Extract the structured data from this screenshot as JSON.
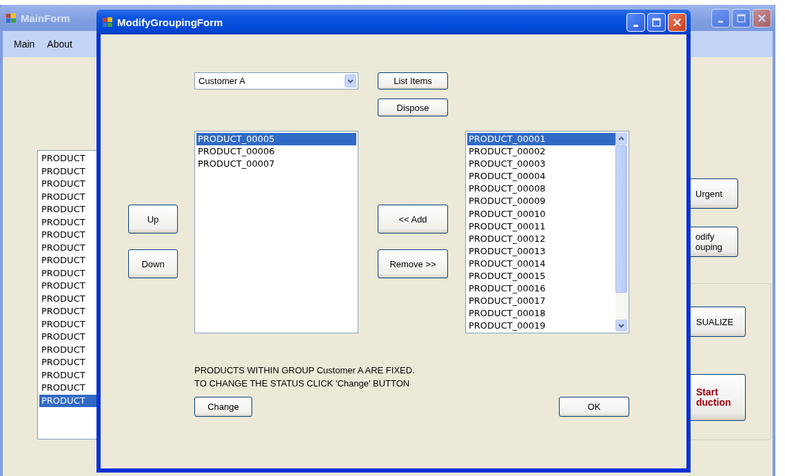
{
  "main_window": {
    "title": "MainForm",
    "menu": [
      {
        "label": "Main"
      },
      {
        "label": "About"
      }
    ],
    "product_list": [
      {
        "label": "PRODUCT",
        "selected": false
      },
      {
        "label": "PRODUCT",
        "selected": false
      },
      {
        "label": "PRODUCT",
        "selected": false
      },
      {
        "label": "PRODUCT",
        "selected": false
      },
      {
        "label": "PRODUCT",
        "selected": false
      },
      {
        "label": "PRODUCT",
        "selected": false
      },
      {
        "label": "PRODUCT",
        "selected": false
      },
      {
        "label": "PRODUCT",
        "selected": false
      },
      {
        "label": "PRODUCT",
        "selected": false
      },
      {
        "label": "PRODUCT",
        "selected": false
      },
      {
        "label": "PRODUCT",
        "selected": false
      },
      {
        "label": "PRODUCT",
        "selected": false
      },
      {
        "label": "PRODUCT",
        "selected": false
      },
      {
        "label": "PRODUCT",
        "selected": false
      },
      {
        "label": "PRODUCT",
        "selected": false
      },
      {
        "label": "PRODUCT",
        "selected": false
      },
      {
        "label": "PRODUCT",
        "selected": false
      },
      {
        "label": "PRODUCT",
        "selected": false
      },
      {
        "label": "PRODUCT",
        "selected": false
      },
      {
        "label": "PRODUCT",
        "selected": true
      }
    ],
    "buttons": [
      {
        "lines": [
          "Urgent"
        ],
        "kind": "plain"
      },
      {
        "lines": [
          "odify",
          "ouping"
        ],
        "kind": "plain"
      }
    ],
    "group_buttons": [
      {
        "lines": [
          "SUALIZE"
        ],
        "kind": "plain"
      },
      {
        "lines": [
          "Start",
          "duction"
        ],
        "kind": "emphasis"
      }
    ]
  },
  "dialog": {
    "title": "ModifyGroupingForm",
    "group_select": {
      "value": "Customer A"
    },
    "list_items_button": "List Items",
    "dispose_button": "Dispose",
    "up_button": "Up",
    "down_button": "Down",
    "group_items": [
      {
        "label": "PRODUCT_00005",
        "selected": true
      },
      {
        "label": "PRODUCT_00006",
        "selected": false
      },
      {
        "label": "PRODUCT_00007",
        "selected": false
      }
    ],
    "add_button": "<< Add",
    "remove_button": "Remove >>",
    "available_items": [
      {
        "label": "PRODUCT_00001",
        "selected": true
      },
      {
        "label": "PRODUCT_00002",
        "selected": false
      },
      {
        "label": "PRODUCT_00003",
        "selected": false
      },
      {
        "label": "PRODUCT_00004",
        "selected": false
      },
      {
        "label": "PRODUCT_00008",
        "selected": false
      },
      {
        "label": "PRODUCT_00009",
        "selected": false
      },
      {
        "label": "PRODUCT_00010",
        "selected": false
      },
      {
        "label": "PRODUCT_00011",
        "selected": false
      },
      {
        "label": "PRODUCT_00012",
        "selected": false
      },
      {
        "label": "PRODUCT_00013",
        "selected": false
      },
      {
        "label": "PRODUCT_00014",
        "selected": false
      },
      {
        "label": "PRODUCT_00015",
        "selected": false
      },
      {
        "label": "PRODUCT_00016",
        "selected": false
      },
      {
        "label": "PRODUCT_00017",
        "selected": false
      },
      {
        "label": "PRODUCT_00018",
        "selected": false
      },
      {
        "label": "PRODUCT_00019",
        "selected": false
      }
    ],
    "message": [
      "PRODUCTS WITHIN GROUP Customer A ARE FIXED.",
      "TO CHANGE THE STATUS CLICK 'Change' BUTTON"
    ],
    "change_button": "Change",
    "ok_button": "OK"
  }
}
